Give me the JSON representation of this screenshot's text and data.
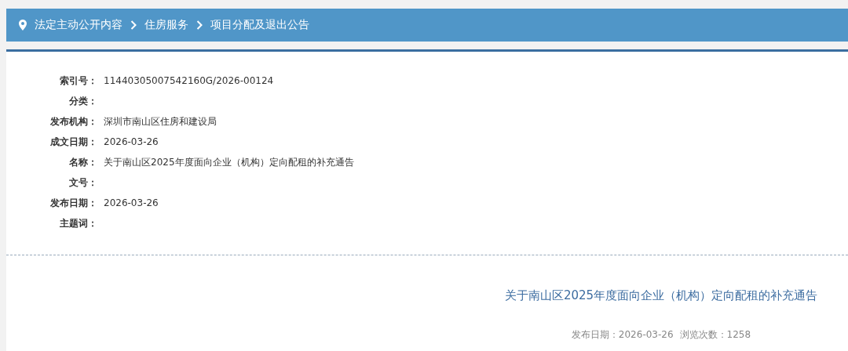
{
  "breadcrumb": [
    "法定主动公开内容",
    "住房服务",
    "项目分配及退出公告"
  ],
  "fields": [
    {
      "label": "索引号：",
      "value": "11440305007542160G/2026-00124"
    },
    {
      "label": "分类："
    },
    {
      "label": "发布机构：",
      "value": "深圳市南山区住房和建设局"
    },
    {
      "label": "成文日期：",
      "value": "2026-03-26"
    },
    {
      "label": "名称：",
      "value": "关于南山区2025年度面向企业（机构）定向配租的补充通告"
    },
    {
      "label": "文号："
    },
    {
      "label": "发布日期：",
      "value": "2026-03-26"
    },
    {
      "label": "主题词："
    }
  ],
  "article": {
    "title": "关于南山区2025年度面向企业（机构）定向配租的补充通告",
    "meta": [
      "发布日期：2026-03-26",
      "浏览次数：1258"
    ]
  }
}
